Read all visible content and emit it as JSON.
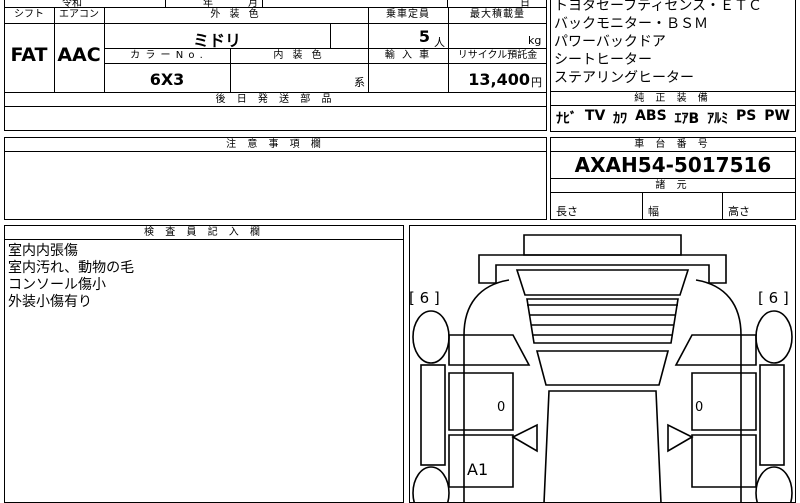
{
  "top_strip": {
    "era": "令和",
    "year_suffix": "年",
    "month_suffix": "月",
    "day_suffix": "日"
  },
  "spec_labels": {
    "shift": "シフト",
    "aircon": "エアコン",
    "exterior_color": "外 装 色",
    "capacity": "乗車定員",
    "max_load": "最大積載量",
    "color_no": "カ ラ ー N o .",
    "interior_color": "内 装 色",
    "import": "輸 入 車",
    "recycle_fee": "リサイクル預託金"
  },
  "spec_values": {
    "shift": "FAT",
    "aircon": "AAC",
    "exterior_color": "ミドリ",
    "capacity": "5",
    "capacity_unit": "人",
    "max_load_unit": "kg",
    "color_no": "6X3",
    "interior_color_suffix": "系",
    "recycle_fee": "13,400",
    "recycle_unit": "円"
  },
  "equipment_notes": [
    "トヨタセーフティセンス・ＥＴＣ",
    "バックモニター・ＢＳＭ",
    "パワーバックドア",
    "シートヒーター",
    "ステアリングヒーター"
  ],
  "sections": {
    "parts_to_send": "後 日 発 送 部 品",
    "genuine_equipment": "純 正 装 備",
    "notes": "注 意 事 項 欄",
    "chassis_number": "車 台 番 号",
    "dimensions": "諸 元",
    "inspector_notes": "検 査 員 記 入 欄"
  },
  "genuine_equipment_items": [
    "ﾅﾋﾞ",
    "TV",
    "ｶﾜ",
    "ABS",
    "ｴｱB",
    "ｱﾙﾐ",
    "PS",
    "PW"
  ],
  "chassis_number": "AXAH54-5017516",
  "dimensions": {
    "length": "長さ",
    "width": "幅",
    "height": "高さ"
  },
  "inspector_remarks": [
    "室内内張傷",
    "室内汚れ、動物の毛",
    "コンソール傷小",
    "外装小傷有り"
  ],
  "diagram": {
    "left_bracket": "[ 6 ]",
    "right_bracket": "[ 6 ]",
    "left_door_mark": "0",
    "right_door_mark": "0",
    "damage_code": "A1"
  }
}
